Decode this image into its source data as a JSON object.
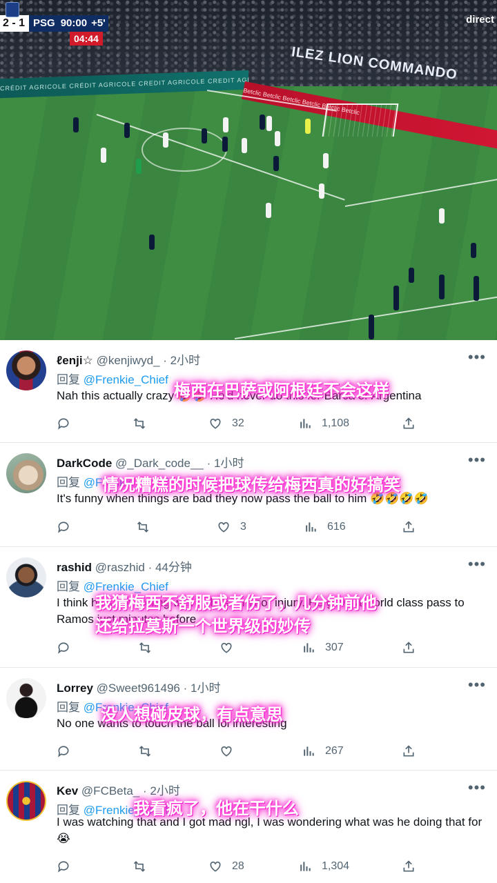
{
  "video": {
    "score": "2 - 1",
    "team": "PSG",
    "clock": "90:00",
    "added_time": "+5'",
    "stoppage": "04:44",
    "live_label": "direct",
    "board_left": "CRÉDIT AGRICOLE   CRÉDIT AGRICOLE   CREDIT AGRICOLE   CREDIT AGRICOLE",
    "board_right": "Betclic   Betclic   Betclic   Betclic   Betclic   Betclic",
    "banner": "ILEZ LION COMMANDO"
  },
  "tweets": [
    {
      "name": "ℓenji☆",
      "handle": "@kenjiwyd_",
      "time": "· 2小时",
      "reply_prefix": "回复",
      "reply_to": "@Frenkie_Chief",
      "text": "Nah this actually crazy 🤣🤣 He'd never do this for Barca or Argentina",
      "subtitle": "梅西在巴萨或阿根廷不会这样",
      "likes": "32",
      "views": "1,108",
      "retweets": ""
    },
    {
      "name": "DarkCode",
      "handle": "@_Dark_code__",
      "time": "· 1小时",
      "reply_prefix": "回复",
      "reply_to": "@Frenkie_Chief",
      "text": "It's funny when things are bad they now pass the ball to him 🤣🤣🤣🤣",
      "subtitle": "情况糟糕的时候把球传给梅西真的好搞笑",
      "likes": "3",
      "views": "616",
      "retweets": ""
    },
    {
      "name": "rashid",
      "handle": "@raszhid",
      "time": "· 44分钟",
      "reply_prefix": "回复",
      "reply_to": "@Frenkie_Chief",
      "text": "I think he's not feeling well or has a minor injury. He gave a world class pass to Ramos just minutes before",
      "subtitle1": "我猜梅西不舒服或者伤了，几分钟前他",
      "subtitle2": "还给拉莫斯一个世界级的妙传",
      "likes": "",
      "views": "307",
      "retweets": ""
    },
    {
      "name": "Lorrey",
      "handle": "@Sweet961496",
      "time": "· 1小时",
      "reply_prefix": "回复",
      "reply_to": "@Frenkie_Chief",
      "text": "No one wants to touch the ball lol interesting",
      "subtitle": "没人想碰皮球，有点意思",
      "likes": "",
      "views": "267",
      "retweets": ""
    },
    {
      "name": "Kev",
      "handle": "@FCBeta_",
      "time": "· 2小时",
      "reply_prefix": "回复",
      "reply_to": "@Frenkie_Chief",
      "text": "I was watching that and I got mad ngl, I was wondering what was he doing that for 😭",
      "subtitle": "我看疯了，他在干什么",
      "likes": "28",
      "views": "1,304",
      "retweets": ""
    }
  ],
  "colors": {
    "link": "#1d9bf0",
    "subtitle_glow": "#ff2bd1",
    "muted": "#536471"
  },
  "icons": [
    "reply-icon",
    "retweet-icon",
    "like-icon",
    "views-icon",
    "share-icon",
    "more-icon"
  ]
}
